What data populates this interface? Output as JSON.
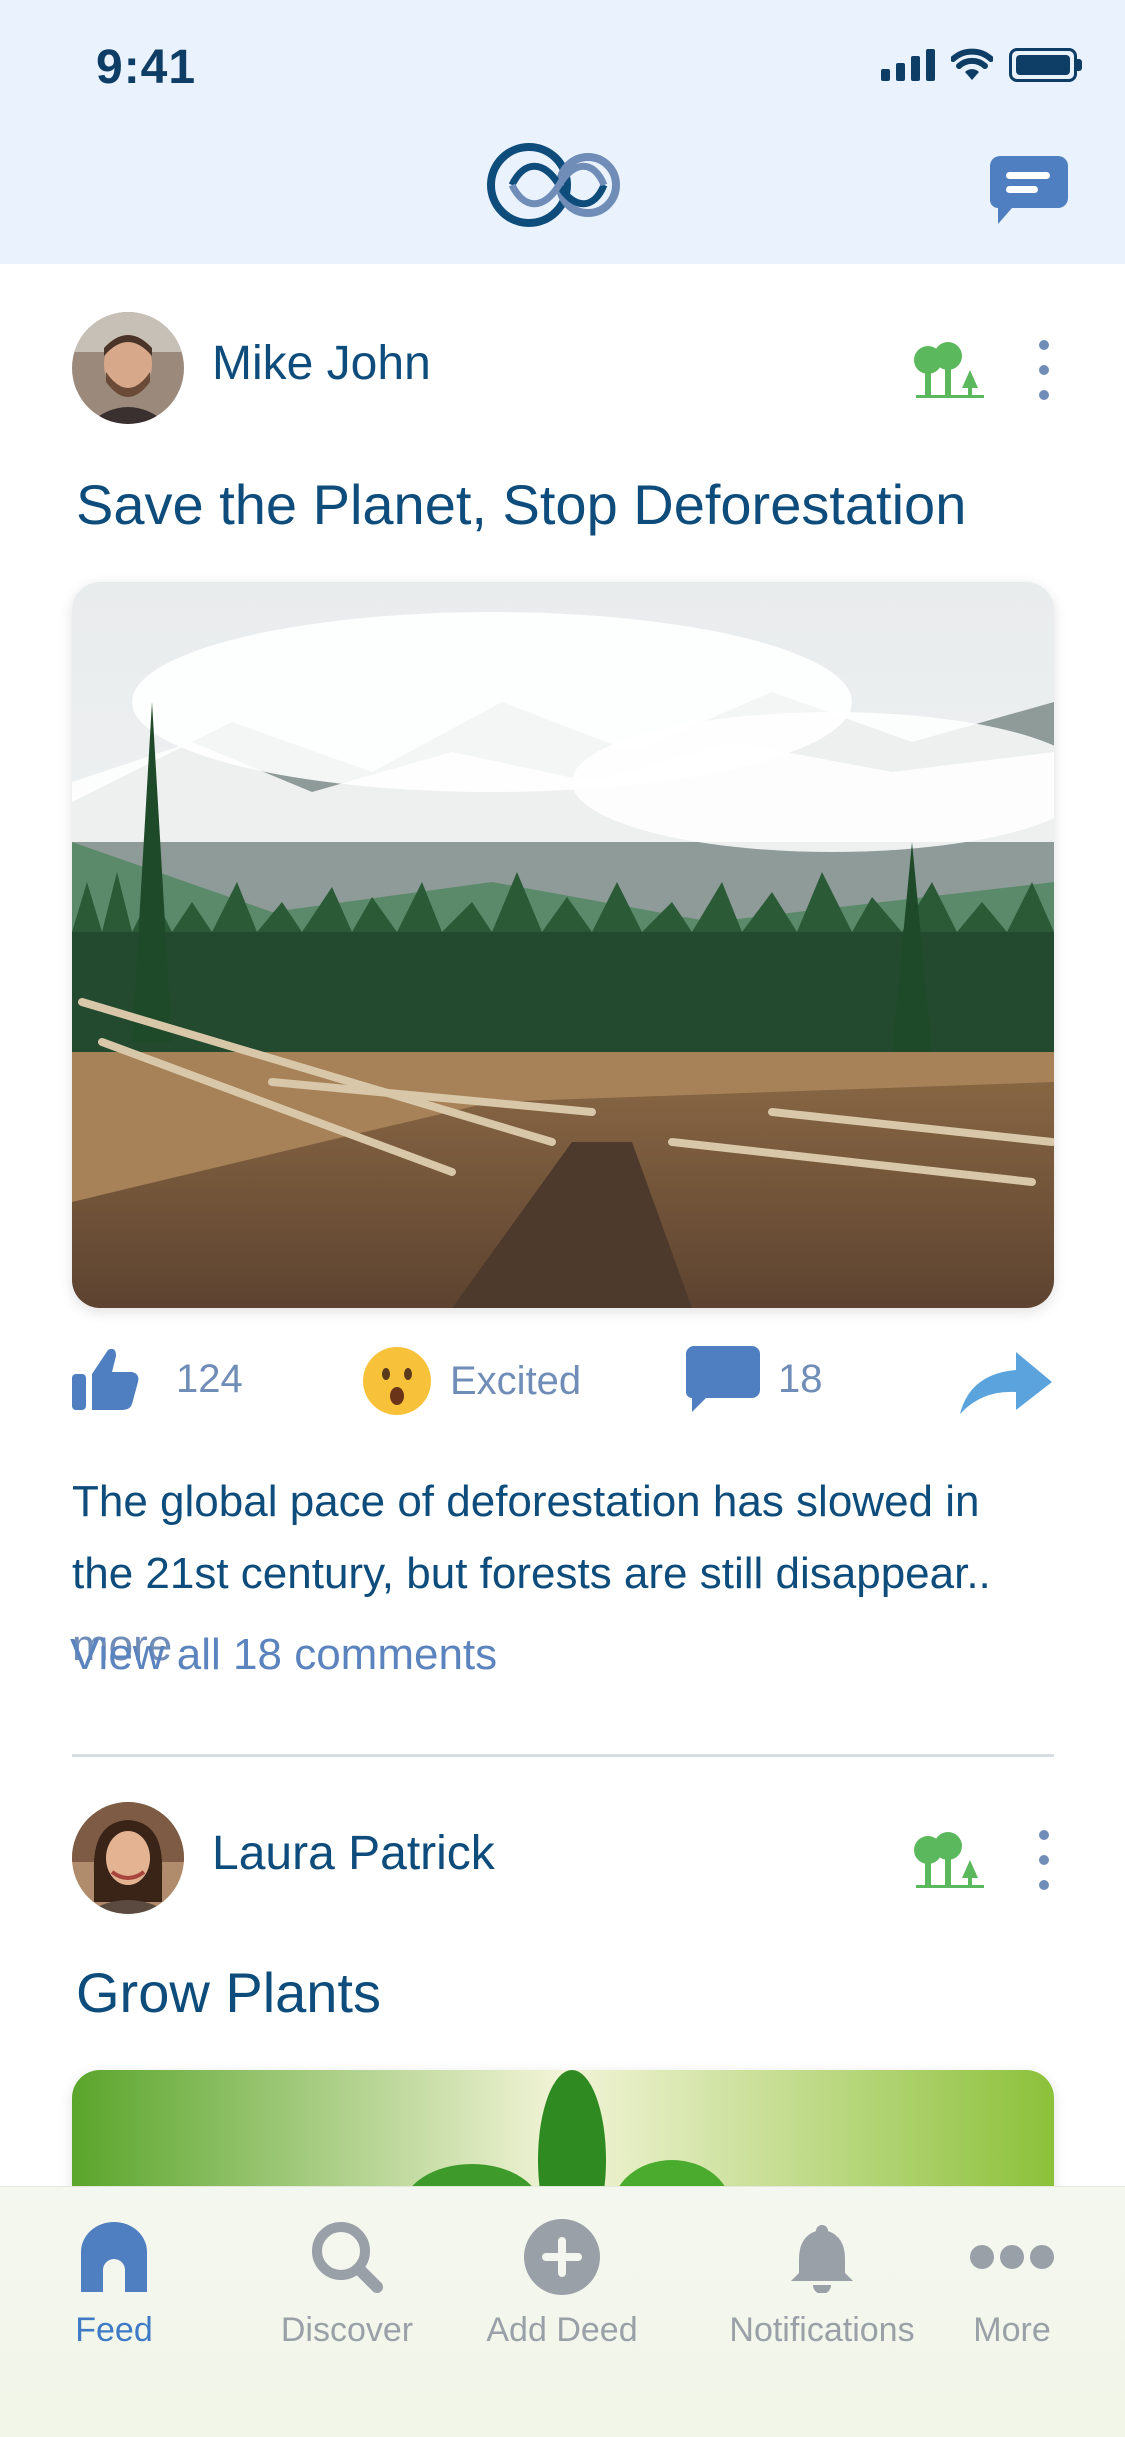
{
  "status_bar": {
    "time": "9:41"
  },
  "colors": {
    "brand_blue": "#0e4c7c",
    "muted_blue": "#6f8db7",
    "link_blue": "#5b83be",
    "tree_green": "#5cb85c",
    "nav_inactive": "#9aa0a8",
    "nav_active": "#3f7ac6"
  },
  "header": {
    "logo_icon": "infinity-logo-icon",
    "chat_icon": "chat-bubble-icon"
  },
  "posts": [
    {
      "author": "Mike John",
      "title": "Save the Planet, Stop Deforestation",
      "likes": "124",
      "reaction": "Excited",
      "comments_count": "18",
      "description": "The global pace of deforestation has slowed in the 21st century, but forests are still disappear..",
      "more_label": "more",
      "view_comments": "View all 18 comments"
    },
    {
      "author": "Laura Patrick",
      "title": "Grow Plants"
    }
  ],
  "bottom_nav": [
    {
      "label": "Feed",
      "icon": "home-icon"
    },
    {
      "label": "Discover",
      "icon": "search-icon"
    },
    {
      "label": "Add Deed",
      "icon": "plus-circle-icon"
    },
    {
      "label": "Notifications",
      "icon": "bell-icon"
    },
    {
      "label": "More",
      "icon": "more-dots-icon"
    }
  ]
}
